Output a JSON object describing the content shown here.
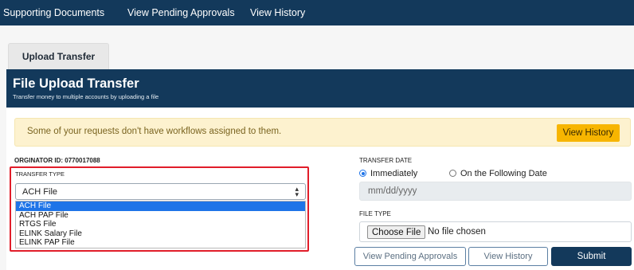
{
  "topnav": {
    "items": [
      "Supporting Documents",
      "View Pending Approvals",
      "View History"
    ]
  },
  "tab": {
    "label": "Upload Transfer"
  },
  "header": {
    "title": "File Upload Transfer",
    "subtitle": "Transfer money to multiple accounts by uploading a file"
  },
  "alert": {
    "message": "Some of your requests don't have workflows assigned to them.",
    "button": "View History"
  },
  "originator": "ORGINATOR ID: 0770017088",
  "transfer_type": {
    "label": "TRANSFER TYPE",
    "selected": "ACH File",
    "options": [
      "ACH File",
      "ACH PAP File",
      "RTGS File",
      "ELINK Salary File",
      "ELINK PAP File"
    ]
  },
  "transfer_date": {
    "label": "TRANSFER DATE",
    "option_immediately": "Immediately",
    "option_following": "On the Following Date",
    "selected": "Immediately",
    "placeholder": "mm/dd/yyyy"
  },
  "file_type": {
    "label": "FILE TYPE",
    "choose_button": "Choose File",
    "status": "No file chosen"
  },
  "actions": {
    "pending": "View Pending Approvals",
    "history": "View History",
    "submit": "Submit"
  },
  "colors": {
    "navy": "#13395b",
    "alert_bg": "#fdf2cf",
    "alert_button": "#f7b500",
    "highlight": "#e11d2a",
    "selected_option": "#1e74e8"
  }
}
